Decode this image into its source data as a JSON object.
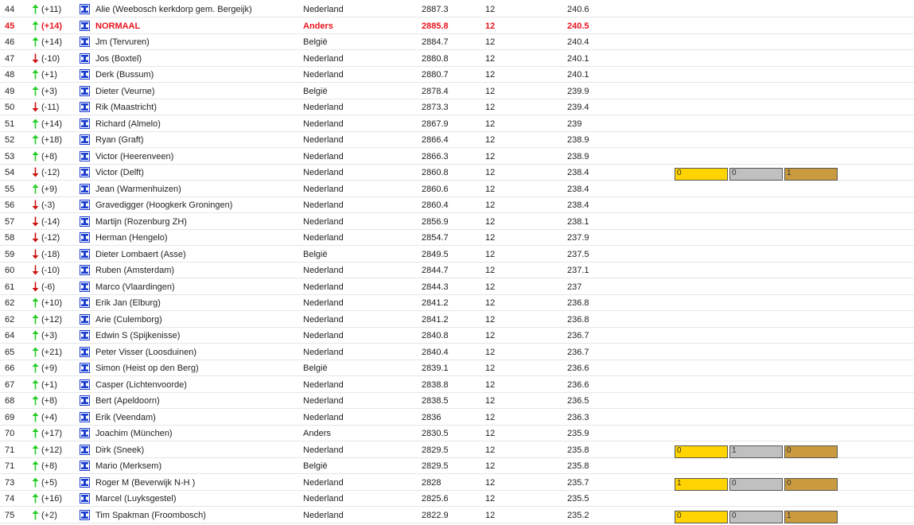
{
  "colors": {
    "up": "#22cc22",
    "down": "#cc1111",
    "highlight": "#e8141e",
    "icon": "#1a3ccf",
    "gold": "#ffd400",
    "silver": "#c0c0c0",
    "bronze": "#c99a3e"
  },
  "rows": [
    {
      "rank": "44",
      "dir": "up",
      "delta": "(+11)",
      "name": "Alie (Weebosch kerkdorp gem. Bergeijk)",
      "country": "Nederland",
      "score": "2887.3",
      "games": "12",
      "avg": "240.6"
    },
    {
      "rank": "45",
      "dir": "up",
      "delta": "(+14)",
      "name": "NORMAAL",
      "country": "Anders",
      "score": "2885.8",
      "games": "12",
      "avg": "240.5",
      "highlight": true
    },
    {
      "rank": "46",
      "dir": "up",
      "delta": "(+14)",
      "name": "Jm (Tervuren)",
      "country": "België",
      "score": "2884.7",
      "games": "12",
      "avg": "240.4"
    },
    {
      "rank": "47",
      "dir": "down",
      "delta": "(-10)",
      "name": "Jos (Boxtel)",
      "country": "Nederland",
      "score": "2880.8",
      "games": "12",
      "avg": "240.1"
    },
    {
      "rank": "48",
      "dir": "up",
      "delta": "(+1)",
      "name": "Derk (Bussum)",
      "country": "Nederland",
      "score": "2880.7",
      "games": "12",
      "avg": "240.1"
    },
    {
      "rank": "49",
      "dir": "up",
      "delta": "(+3)",
      "name": "Dieter (Veurne)",
      "country": "België",
      "score": "2878.4",
      "games": "12",
      "avg": "239.9"
    },
    {
      "rank": "50",
      "dir": "down",
      "delta": "(-11)",
      "name": "Rik (Maastricht)",
      "country": "Nederland",
      "score": "2873.3",
      "games": "12",
      "avg": "239.4"
    },
    {
      "rank": "51",
      "dir": "up",
      "delta": "(+14)",
      "name": "Richard (Almelo)",
      "country": "Nederland",
      "score": "2867.9",
      "games": "12",
      "avg": "239"
    },
    {
      "rank": "52",
      "dir": "up",
      "delta": "(+18)",
      "name": "Ryan (Graft)",
      "country": "Nederland",
      "score": "2866.4",
      "games": "12",
      "avg": "238.9"
    },
    {
      "rank": "53",
      "dir": "up",
      "delta": "(+8)",
      "name": "Victor (Heerenveen)",
      "country": "Nederland",
      "score": "2866.3",
      "games": "12",
      "avg": "238.9"
    },
    {
      "rank": "54",
      "dir": "down",
      "delta": "(-12)",
      "name": "Victor (Delft)",
      "country": "Nederland",
      "score": "2860.8",
      "games": "12",
      "avg": "238.4",
      "medals": {
        "gold": "0",
        "silver": "0",
        "bronze": "1"
      }
    },
    {
      "rank": "55",
      "dir": "up",
      "delta": "(+9)",
      "name": "Jean (Warmenhuizen)",
      "country": "Nederland",
      "score": "2860.6",
      "games": "12",
      "avg": "238.4"
    },
    {
      "rank": "56",
      "dir": "down",
      "delta": "(-3)",
      "name": "Gravedigger (Hoogkerk Groningen)",
      "country": "Nederland",
      "score": "2860.4",
      "games": "12",
      "avg": "238.4"
    },
    {
      "rank": "57",
      "dir": "down",
      "delta": "(-14)",
      "name": "Martijn (Rozenburg ZH)",
      "country": "Nederland",
      "score": "2856.9",
      "games": "12",
      "avg": "238.1"
    },
    {
      "rank": "58",
      "dir": "down",
      "delta": "(-12)",
      "name": "Herman (Hengelo)",
      "country": "Nederland",
      "score": "2854.7",
      "games": "12",
      "avg": "237.9"
    },
    {
      "rank": "59",
      "dir": "down",
      "delta": "(-18)",
      "name": "Dieter Lombaert (Asse)",
      "country": "België",
      "score": "2849.5",
      "games": "12",
      "avg": "237.5"
    },
    {
      "rank": "60",
      "dir": "down",
      "delta": "(-10)",
      "name": "Ruben (Amsterdam)",
      "country": "Nederland",
      "score": "2844.7",
      "games": "12",
      "avg": "237.1"
    },
    {
      "rank": "61",
      "dir": "down",
      "delta": "(-6)",
      "name": "Marco (Vlaardingen)",
      "country": "Nederland",
      "score": "2844.3",
      "games": "12",
      "avg": "237"
    },
    {
      "rank": "62",
      "dir": "up",
      "delta": "(+10)",
      "name": "Erik Jan (Elburg)",
      "country": "Nederland",
      "score": "2841.2",
      "games": "12",
      "avg": "236.8"
    },
    {
      "rank": "62",
      "dir": "up",
      "delta": "(+12)",
      "name": "Arie (Culemborg)",
      "country": "Nederland",
      "score": "2841.2",
      "games": "12",
      "avg": "236.8"
    },
    {
      "rank": "64",
      "dir": "up",
      "delta": "(+3)",
      "name": "Edwin S (Spijkenisse)",
      "country": "Nederland",
      "score": "2840.8",
      "games": "12",
      "avg": "236.7"
    },
    {
      "rank": "65",
      "dir": "up",
      "delta": "(+21)",
      "name": "Peter Visser (Loosduinen)",
      "country": "Nederland",
      "score": "2840.4",
      "games": "12",
      "avg": "236.7"
    },
    {
      "rank": "66",
      "dir": "up",
      "delta": "(+9)",
      "name": "Simon (Heist op den Berg)",
      "country": "België",
      "score": "2839.1",
      "games": "12",
      "avg": "236.6"
    },
    {
      "rank": "67",
      "dir": "up",
      "delta": "(+1)",
      "name": "Casper (Lichtenvoorde)",
      "country": "Nederland",
      "score": "2838.8",
      "games": "12",
      "avg": "236.6"
    },
    {
      "rank": "68",
      "dir": "up",
      "delta": "(+8)",
      "name": "Bert (Apeldoorn)",
      "country": "Nederland",
      "score": "2838.5",
      "games": "12",
      "avg": "236.5"
    },
    {
      "rank": "69",
      "dir": "up",
      "delta": "(+4)",
      "name": "Erik (Veendam)",
      "country": "Nederland",
      "score": "2836",
      "games": "12",
      "avg": "236.3"
    },
    {
      "rank": "70",
      "dir": "up",
      "delta": "(+17)",
      "name": "Joachim (München)",
      "country": "Anders",
      "score": "2830.5",
      "games": "12",
      "avg": "235.9"
    },
    {
      "rank": "71",
      "dir": "up",
      "delta": "(+12)",
      "name": "Dirk (Sneek)",
      "country": "Nederland",
      "score": "2829.5",
      "games": "12",
      "avg": "235.8",
      "medals": {
        "gold": "0",
        "silver": "1",
        "bronze": "0"
      }
    },
    {
      "rank": "71",
      "dir": "up",
      "delta": "(+8)",
      "name": "Mario (Merksem)",
      "country": "België",
      "score": "2829.5",
      "games": "12",
      "avg": "235.8"
    },
    {
      "rank": "73",
      "dir": "up",
      "delta": "(+5)",
      "name": "Roger M (Beverwijk N-H )",
      "country": "Nederland",
      "score": "2828",
      "games": "12",
      "avg": "235.7",
      "medals": {
        "gold": "1",
        "silver": "0",
        "bronze": "0"
      }
    },
    {
      "rank": "74",
      "dir": "up",
      "delta": "(+16)",
      "name": "Marcel (Luyksgestel)",
      "country": "Nederland",
      "score": "2825.6",
      "games": "12",
      "avg": "235.5"
    },
    {
      "rank": "75",
      "dir": "up",
      "delta": "(+2)",
      "name": "Tim Spakman (Froombosch)",
      "country": "Nederland",
      "score": "2822.9",
      "games": "12",
      "avg": "235.2",
      "medals": {
        "gold": "0",
        "silver": "0",
        "bronze": "1"
      }
    }
  ]
}
